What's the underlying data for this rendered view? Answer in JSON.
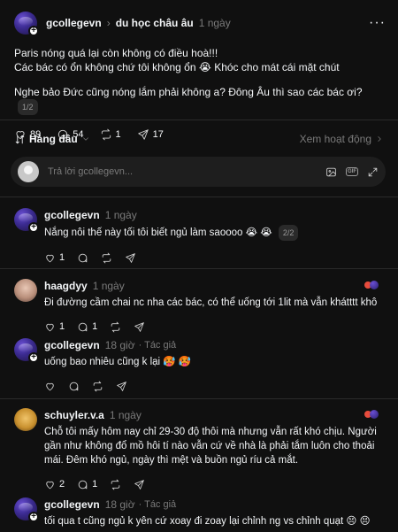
{
  "post": {
    "username": "gcollegevn",
    "separator": "›",
    "community": "du học châu âu",
    "time": "1 ngày",
    "more": "···",
    "text_line1": "Paris nóng quá lại còn không có điều hoà!!!",
    "text_line2": "Các bác có ổn không chứ tôi không ổn 😭 Khóc cho mát cái mặt chút",
    "text_line3": "Nghe bảo Đức cũng nóng lắm phải không a? Đông Âu thì sao các bác ơi?",
    "pager": "1/2",
    "likes": "89",
    "comments": "54",
    "reposts": "1",
    "shares": "17"
  },
  "sortbar": {
    "label": "Hàng đầu",
    "view_activity": "Xem hoạt động"
  },
  "composer": {
    "placeholder": "Trả lời gcollegevn..."
  },
  "comments": [
    {
      "username": "gcollegevn",
      "time": "1 ngày",
      "text": "Nắng nôi thế này tối tôi biết ngủ làm saoooo 😭 😭",
      "pager": "2/2",
      "likes": "1",
      "comments": "",
      "reposts": ""
    },
    {
      "username": "haagdyy",
      "time": "1 ngày",
      "text": "Đi đường cầm chai nc nha các bác, có thể uống tới 1lit mà vẫn khátttt khô",
      "likes": "1",
      "comments": "1",
      "reposts": ""
    },
    {
      "username": "gcollegevn",
      "time": "18 giờ",
      "author_tag": "· Tác giả",
      "text": "uống bao nhiêu cũng k lại 🥵 🥵",
      "likes": "",
      "comments": "",
      "reposts": ""
    },
    {
      "username": "schuyler.v.a",
      "time": "1 ngày",
      "text": "Chỗ tôi mấy hôm nay chỉ 29-30 độ thôi mà nhưng vẫn rất khó chịu. Người gần như không đổ mồ hôi tí nào vẫn cứ về nhà là phải tắm luôn cho thoải mái. Đêm khó ngủ, ngày thì mệt và buồn ngủ ríu cả mắt.",
      "likes": "2",
      "comments": "1",
      "reposts": ""
    },
    {
      "username": "gcollegevn",
      "time": "18 giờ",
      "author_tag": "· Tác giả",
      "text": "tối qua t cũng ngủ k yên cứ xoay đi zoay lại chỉnh ng vs chỉnh quạt 😣 😣"
    }
  ]
}
